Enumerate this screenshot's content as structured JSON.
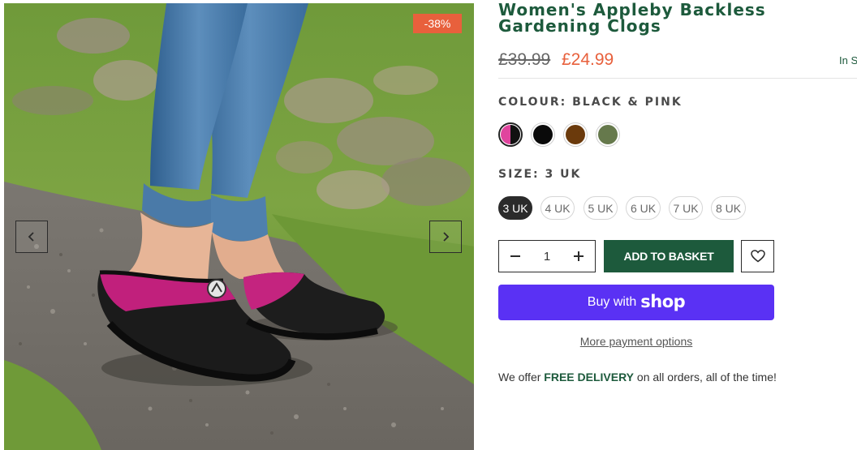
{
  "gallery": {
    "discount_badge": "-38%",
    "prev_icon": "chevron-left-icon",
    "next_icon": "chevron-right-icon"
  },
  "product": {
    "title": "Women's Appleby Backless Gardening Clogs",
    "price_original": "£39.99",
    "price_sale": "£24.99",
    "stock_status": "In S"
  },
  "colour": {
    "label": "COLOUR: BLACK & PINK",
    "swatches": [
      {
        "name": "Black & Pink",
        "colors": [
          "#e0449e",
          "#111111"
        ],
        "selected": true
      },
      {
        "name": "Black",
        "colors": [
          "#0a0a0a"
        ],
        "selected": false
      },
      {
        "name": "Brown",
        "colors": [
          "#6b3a0c"
        ],
        "selected": false
      },
      {
        "name": "Green",
        "colors": [
          "#66794c"
        ],
        "selected": false
      }
    ]
  },
  "size": {
    "label": "SIZE: 3 UK",
    "options": [
      "3 UK",
      "4 UK",
      "5 UK",
      "6 UK",
      "7 UK",
      "8 UK"
    ],
    "selected": "3 UK"
  },
  "purchase": {
    "quantity": "1",
    "minus_icon": "minus-icon",
    "plus_icon": "plus-icon",
    "add_to_basket": "ADD TO BASKET",
    "wishlist_icon": "heart-icon"
  },
  "shop_pay": {
    "lead": "Buy with",
    "brand": "shop",
    "more_options": "More payment options"
  },
  "delivery": {
    "prefix": "We offer ",
    "highlight": "FREE DELIVERY",
    "suffix": " on all orders, all of the time!"
  },
  "colors": {
    "brand_green": "#1d5a3c",
    "sale_orange": "#e8603c",
    "shop_purple": "#5a31f4"
  }
}
